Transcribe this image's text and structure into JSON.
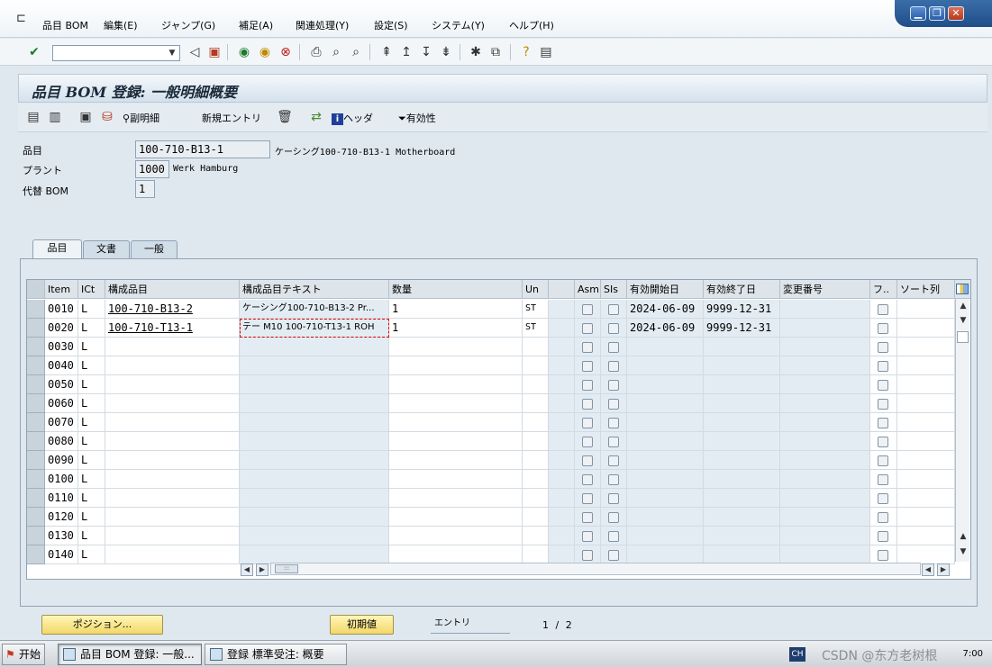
{
  "menubar": {
    "items": [
      "品目 BOM",
      "編集(E)",
      "ジャンプ(G)",
      "補足(A)",
      "関連処理(Y)",
      "設定(S)",
      "システム(Y)",
      "ヘルプ(H)"
    ]
  },
  "window_controls": {
    "minimize": "▁",
    "restore": "❐",
    "close": "✕"
  },
  "title": "品目 BOM 登録: 一般明細概要",
  "app_toolbar": {
    "sub_detail": "副明細",
    "new_entry": "新規エントリ",
    "header": "ヘッダ",
    "validity": "有効性"
  },
  "header": {
    "material_label": "品目",
    "material_value": "100-710-B13-1",
    "material_desc": "ケーシング100-710-B13-1 Motherboard",
    "plant_label": "プラント",
    "plant_value": "1000",
    "plant_desc": "Werk Hamburg",
    "alt_bom_label": "代替 BOM",
    "alt_bom_value": "1"
  },
  "tabs": [
    "品目",
    "文書",
    "一般"
  ],
  "grid": {
    "columns": [
      "Item",
      "ICt",
      "構成品目",
      "構成品目テキスト",
      "数量",
      "Un",
      "",
      "Asm",
      "SIs",
      "有効開始日",
      "有効終了日",
      "変更番号",
      "フ..",
      "ソート列"
    ],
    "rows": [
      {
        "item": "0010",
        "ict": "L",
        "component": "100-710-B13-2",
        "text": "ケーシング100-710-B13-2 Pr...",
        "qty": "1",
        "un": "ST",
        "from": "2024-06-09",
        "to": "9999-12-31"
      },
      {
        "item": "0020",
        "ict": "L",
        "component": "100-710-T13-1",
        "text": "テー M10 100-710-T13-1 ROH",
        "qty": "1",
        "un": "ST",
        "from": "2024-06-09",
        "to": "9999-12-31"
      },
      {
        "item": "0030",
        "ict": "L",
        "component": "",
        "text": "",
        "qty": "",
        "un": "",
        "from": "",
        "to": ""
      },
      {
        "item": "0040",
        "ict": "L",
        "component": "",
        "text": "",
        "qty": "",
        "un": "",
        "from": "",
        "to": ""
      },
      {
        "item": "0050",
        "ict": "L",
        "component": "",
        "text": "",
        "qty": "",
        "un": "",
        "from": "",
        "to": ""
      },
      {
        "item": "0060",
        "ict": "L",
        "component": "",
        "text": "",
        "qty": "",
        "un": "",
        "from": "",
        "to": ""
      },
      {
        "item": "0070",
        "ict": "L",
        "component": "",
        "text": "",
        "qty": "",
        "un": "",
        "from": "",
        "to": ""
      },
      {
        "item": "0080",
        "ict": "L",
        "component": "",
        "text": "",
        "qty": "",
        "un": "",
        "from": "",
        "to": ""
      },
      {
        "item": "0090",
        "ict": "L",
        "component": "",
        "text": "",
        "qty": "",
        "un": "",
        "from": "",
        "to": ""
      },
      {
        "item": "0100",
        "ict": "L",
        "component": "",
        "text": "",
        "qty": "",
        "un": "",
        "from": "",
        "to": ""
      },
      {
        "item": "0110",
        "ict": "L",
        "component": "",
        "text": "",
        "qty": "",
        "un": "",
        "from": "",
        "to": ""
      },
      {
        "item": "0120",
        "ict": "L",
        "component": "",
        "text": "",
        "qty": "",
        "un": "",
        "from": "",
        "to": ""
      },
      {
        "item": "0130",
        "ict": "L",
        "component": "",
        "text": "",
        "qty": "",
        "un": "",
        "from": "",
        "to": ""
      },
      {
        "item": "0140",
        "ict": "L",
        "component": "",
        "text": "",
        "qty": "",
        "un": "",
        "from": "",
        "to": ""
      }
    ]
  },
  "footer": {
    "position_button": "ポジション...",
    "initial_button": "初期値",
    "entry_label": "エントリ",
    "page_current": "1",
    "page_sep": "/",
    "page_total": "2"
  },
  "taskbar": {
    "start": "开始",
    "task1": "品目 BOM 登録: 一般...",
    "task2": "登録 標準受注: 概要",
    "ime": "CH",
    "watermark": "CSDN @东方老树根",
    "clock": "7:00"
  },
  "colors": {
    "accent": "#1f4d88",
    "button_yellow": "#f2d868",
    "panel": "#dfe8ef"
  }
}
